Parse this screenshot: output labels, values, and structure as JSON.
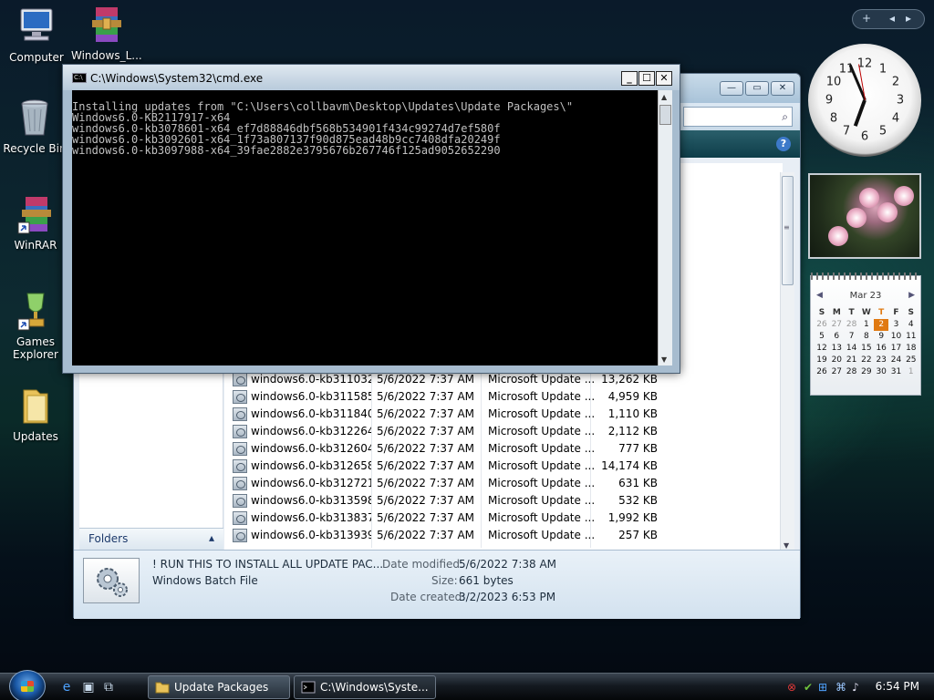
{
  "desktop": {
    "icons": [
      {
        "label": "Computer"
      },
      {
        "label": "Windows_L..."
      },
      {
        "label": "Recycle Bin"
      },
      {
        "label": "WinRAR"
      },
      {
        "label": "Games Explorer"
      },
      {
        "label": "Updates"
      }
    ]
  },
  "cmd": {
    "title": "C:\\Windows\\System32\\cmd.exe",
    "lines": [
      "Installing updates from \"C:\\Users\\collbavm\\Desktop\\Updates\\Update Packages\\\"",
      "",
      "Windows6.0-KB2117917-x64",
      "windows6.0-kb3078601-x64_ef7d88846dbf568b534901f434c99274d7ef580f",
      "windows6.0-kb3092601-x64_1f73a807137f90d875ead48b9cc7408dfa20249f",
      "windows6.0-kb3097988-x64_39fae2882e3795676b267746f125ad9052652290"
    ],
    "minimize": "_",
    "maximize": "☐",
    "close": "✕"
  },
  "explorer": {
    "minimize": "—",
    "maximize": "▭",
    "close": "✕",
    "help": "?",
    "folders_label": "Folders",
    "files": [
      {
        "name": "windows6.0-kb311032...",
        "date": "5/6/2022 7:37 AM",
        "type": "Microsoft Update ...",
        "size": "13,262 KB"
      },
      {
        "name": "windows6.0-kb311585...",
        "date": "5/6/2022 7:37 AM",
        "type": "Microsoft Update ...",
        "size": "4,959 KB"
      },
      {
        "name": "windows6.0-kb311840...",
        "date": "5/6/2022 7:37 AM",
        "type": "Microsoft Update ...",
        "size": "1,110 KB"
      },
      {
        "name": "windows6.0-kb312264...",
        "date": "5/6/2022 7:37 AM",
        "type": "Microsoft Update ...",
        "size": "2,112 KB"
      },
      {
        "name": "windows6.0-kb312604...",
        "date": "5/6/2022 7:37 AM",
        "type": "Microsoft Update ...",
        "size": "777 KB"
      },
      {
        "name": "windows6.0-kb312658...",
        "date": "5/6/2022 7:37 AM",
        "type": "Microsoft Update ...",
        "size": "14,174 KB"
      },
      {
        "name": "windows6.0-kb312721...",
        "date": "5/6/2022 7:37 AM",
        "type": "Microsoft Update ...",
        "size": "631 KB"
      },
      {
        "name": "windows6.0-kb313598...",
        "date": "5/6/2022 7:37 AM",
        "type": "Microsoft Update ...",
        "size": "532 KB"
      },
      {
        "name": "windows6.0-kb313837...",
        "date": "5/6/2022 7:37 AM",
        "type": "Microsoft Update ...",
        "size": "1,992 KB"
      },
      {
        "name": "windows6.0-kb313939...",
        "date": "5/6/2022 7:37 AM",
        "type": "Microsoft Update ...",
        "size": "257 KB"
      }
    ],
    "details": {
      "name": "! RUN THIS TO INSTALL ALL UPDATE PAC...",
      "type": "Windows Batch File",
      "date_modified_key": "Date modified:",
      "date_modified": "5/6/2022 7:38 AM",
      "size_key": "Size:",
      "size": "661 bytes",
      "date_created_key": "Date created:",
      "date_created": "3/2/2023 6:53 PM"
    }
  },
  "gadgets": {
    "add": "+",
    "prev": "◂",
    "next": "▸",
    "clock_numbers": [
      "12",
      "1",
      "2",
      "3",
      "4",
      "5",
      "6",
      "7",
      "8",
      "9",
      "10",
      "11"
    ],
    "calendar": {
      "month": "Mar 23",
      "weekdays": [
        "S",
        "M",
        "T",
        "W",
        "T",
        "F",
        "S"
      ],
      "today_weekday_index": 4,
      "weeks": [
        [
          "26",
          "27",
          "28",
          "1",
          "2",
          "3",
          "4"
        ],
        [
          "5",
          "6",
          "7",
          "8",
          "9",
          "10",
          "11"
        ],
        [
          "12",
          "13",
          "14",
          "15",
          "16",
          "17",
          "18"
        ],
        [
          "19",
          "20",
          "21",
          "22",
          "23",
          "24",
          "25"
        ],
        [
          "26",
          "27",
          "28",
          "29",
          "30",
          "31",
          "1"
        ]
      ],
      "today": "2",
      "prev_arrow": "◀",
      "next_arrow": "▶"
    }
  },
  "taskbar": {
    "tasks": [
      {
        "label": "Update Packages"
      },
      {
        "label": "C:\\Windows\\Syste..."
      }
    ],
    "time": "6:54 PM"
  },
  "colors": {
    "accent": "#1b5aa8",
    "today": "#e07a12"
  }
}
